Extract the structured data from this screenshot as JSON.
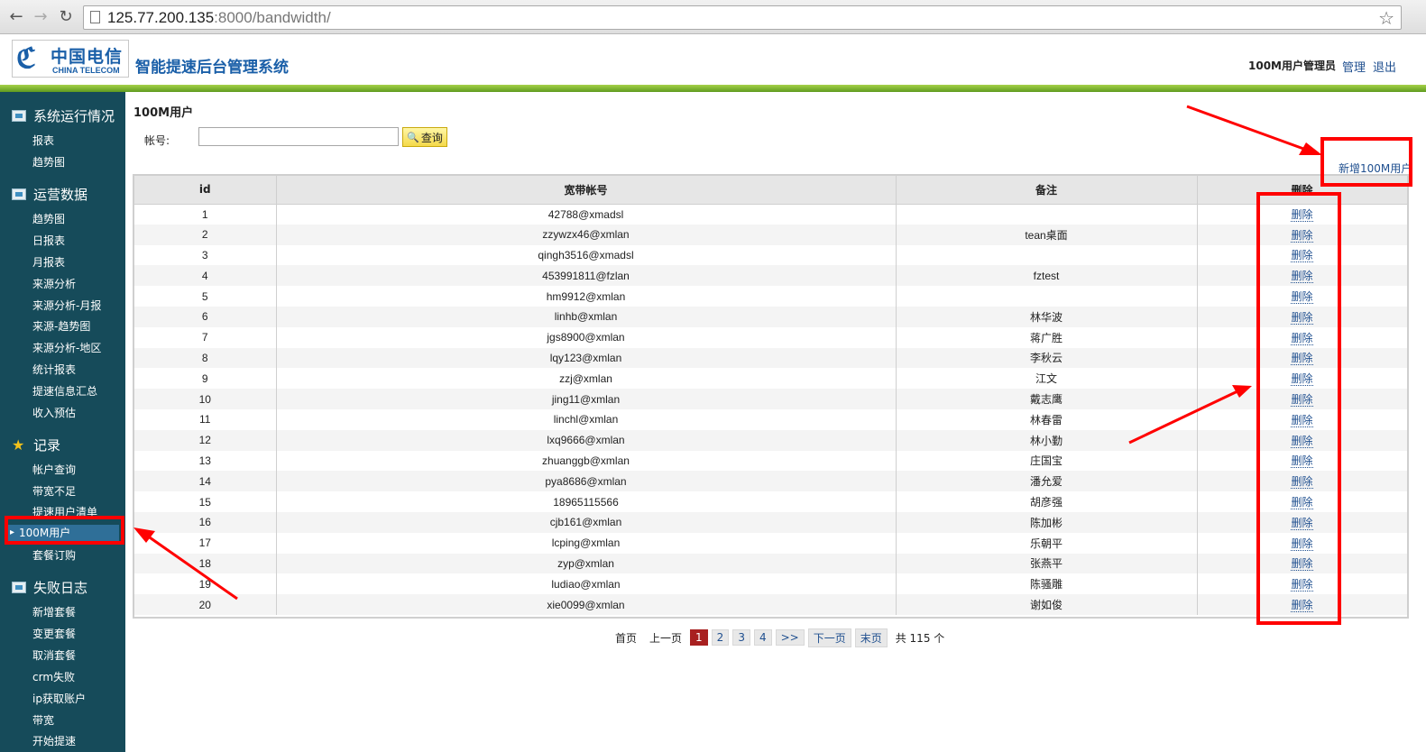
{
  "browser": {
    "url_host": "125.77.200.135",
    "url_rest": ":8000/bandwidth/"
  },
  "header": {
    "logo_cn": "中国电信",
    "logo_en": "CHINA TELECOM",
    "system_title": "智能提速后台管理系统",
    "user_role": "100M用户管理员",
    "manage_label": "管理",
    "logout_label": "退出"
  },
  "sidebar": {
    "sections": [
      {
        "title": "系统运行情况",
        "items": [
          "报表",
          "趋势图"
        ]
      },
      {
        "title": "运营数据",
        "items": [
          "趋势图",
          "日报表",
          "月报表",
          "来源分析",
          "来源分析-月报",
          "来源-趋势图",
          "来源分析-地区",
          "统计报表",
          "提速信息汇总",
          "收入预估"
        ]
      },
      {
        "title": "记录",
        "items": [
          "帐户查询",
          "带宽不足",
          "提速用户清单",
          "100M用户",
          "套餐订购"
        ]
      },
      {
        "title": "失败日志",
        "items": [
          "新增套餐",
          "变更套餐",
          "取消套餐",
          "crm失败",
          "ip获取账户",
          "带宽",
          "开始提速"
        ]
      }
    ]
  },
  "main": {
    "page_title": "100M用户",
    "account_label": "帐号:",
    "account_value": "",
    "search_label": "查询",
    "add_label": "新增100M用户",
    "columns": [
      "id",
      "宽带帐号",
      "备注",
      "删除"
    ],
    "delete_label": "删除",
    "rows": [
      {
        "id": "1",
        "account": "42788@xmadsl",
        "note": ""
      },
      {
        "id": "2",
        "account": "zzywzx46@xmlan",
        "note": "tean桌面"
      },
      {
        "id": "3",
        "account": "qingh3516@xmadsl",
        "note": ""
      },
      {
        "id": "4",
        "account": "453991811@fzlan",
        "note": "fztest"
      },
      {
        "id": "5",
        "account": "hm9912@xmlan",
        "note": ""
      },
      {
        "id": "6",
        "account": "linhb@xmlan",
        "note": "林华波"
      },
      {
        "id": "7",
        "account": "jgs8900@xmlan",
        "note": "蒋广胜"
      },
      {
        "id": "8",
        "account": "lqy123@xmlan",
        "note": "李秋云"
      },
      {
        "id": "9",
        "account": "zzj@xmlan",
        "note": "江文"
      },
      {
        "id": "10",
        "account": "jing11@xmlan",
        "note": "戴志鹰"
      },
      {
        "id": "11",
        "account": "linchl@xmlan",
        "note": "林春雷"
      },
      {
        "id": "12",
        "account": "lxq9666@xmlan",
        "note": "林小勤"
      },
      {
        "id": "13",
        "account": "zhuanggb@xmlan",
        "note": "庄国宝"
      },
      {
        "id": "14",
        "account": "pya8686@xmlan",
        "note": "潘允爱"
      },
      {
        "id": "15",
        "account": "18965115566",
        "note": "胡彦强"
      },
      {
        "id": "16",
        "account": "cjb161@xmlan",
        "note": "陈加彬"
      },
      {
        "id": "17",
        "account": "lcping@xmlan",
        "note": "乐朝平"
      },
      {
        "id": "18",
        "account": "zyp@xmlan",
        "note": "张燕平"
      },
      {
        "id": "19",
        "account": "ludiao@xmlan",
        "note": "陈骚雕"
      },
      {
        "id": "20",
        "account": "xie0099@xmlan",
        "note": "谢如俊"
      }
    ],
    "pager": {
      "first": "首页",
      "prev": "上一页",
      "pages": [
        "1",
        "2",
        "3",
        "4"
      ],
      "current": "1",
      "more": ">>",
      "next": "下一页",
      "last": "末页",
      "total": "共 115 个"
    }
  },
  "colors": {
    "sidebar_bg": "#164b5a",
    "accent_green": "#7db63a",
    "annotation_red": "#ff0000",
    "pager_current": "#a82020"
  }
}
